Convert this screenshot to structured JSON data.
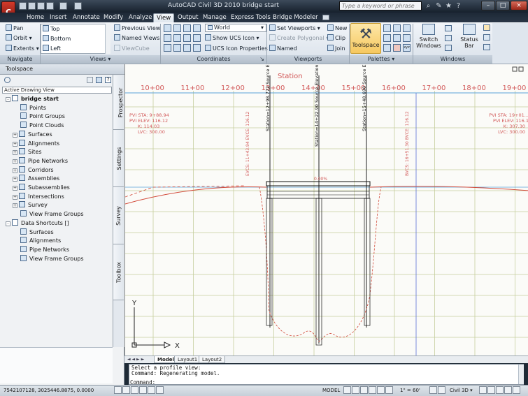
{
  "app": {
    "logo": "C",
    "title": "AutoCAD Civil 3D 2010    bridge start",
    "search_placeholder": "Type a keyword or phrase"
  },
  "ribbon_tabs": [
    "Home",
    "Insert",
    "Annotate",
    "Modify",
    "Analyze",
    "View",
    "Output",
    "Manage",
    "Express Tools",
    "Bridge Modeler"
  ],
  "active_tab": "View",
  "ribbon": {
    "navigate": {
      "label": "Navigate",
      "items": [
        "Pan",
        "Orbit",
        "Extents"
      ]
    },
    "views": {
      "label": "Views",
      "list": [
        "Top",
        "Bottom",
        "Left"
      ],
      "buttons": [
        "Previous View",
        "Named Views",
        "ViewCube"
      ]
    },
    "coordinates": {
      "label": "Coordinates",
      "ucs_combo": "World",
      "show_ucs": "Show UCS Icon",
      "ucs_props": "UCS Icon Properties"
    },
    "viewports": {
      "label": "Viewports",
      "set": "Set Viewports",
      "create": "Create Polygonal",
      "named": "Named",
      "new": "New",
      "clip": "Clip",
      "join": "Join"
    },
    "palettes": {
      "label": "Palettes",
      "toolspace": "Toolspace"
    },
    "windows": {
      "label": "Windows",
      "switch": "Switch Windows",
      "status": "Status Bar"
    }
  },
  "toolspace": {
    "title": "Toolspace",
    "view_combo": "Active Drawing View",
    "tree": [
      {
        "label": "bridge start",
        "level": 0,
        "bold": true,
        "expander": "-"
      },
      {
        "label": "Points",
        "level": 1
      },
      {
        "label": "Point Groups",
        "level": 1
      },
      {
        "label": "Point Clouds",
        "level": 1
      },
      {
        "label": "Surfaces",
        "level": 1,
        "expander": "+"
      },
      {
        "label": "Alignments",
        "level": 1,
        "expander": "+"
      },
      {
        "label": "Sites",
        "level": 1,
        "expander": "+"
      },
      {
        "label": "Pipe Networks",
        "level": 1,
        "expander": "+"
      },
      {
        "label": "Corridors",
        "level": 1,
        "expander": "+"
      },
      {
        "label": "Assemblies",
        "level": 1,
        "expander": "+"
      },
      {
        "label": "Subassemblies",
        "level": 1,
        "expander": "+"
      },
      {
        "label": "Intersections",
        "level": 1,
        "expander": "+"
      },
      {
        "label": "Survey",
        "level": 1,
        "expander": "+"
      },
      {
        "label": "View Frame Groups",
        "level": 1
      },
      {
        "label": "Data Shortcuts []",
        "level": 0,
        "expander": "-"
      },
      {
        "label": "Surfaces",
        "level": 1
      },
      {
        "label": "Alignments",
        "level": 1
      },
      {
        "label": "Pipe Networks",
        "level": 1
      },
      {
        "label": "View Frame Groups",
        "level": 1
      }
    ],
    "vertical_tabs": [
      "Prospector",
      "Settings",
      "Survey",
      "Toolbox"
    ]
  },
  "drawing": {
    "header": "Station",
    "stations": [
      "10+00",
      "11+00",
      "12+00",
      "13+00",
      "14+00",
      "15+00",
      "16+00",
      "17+00",
      "18+00",
      "19+00"
    ],
    "pvi_left": [
      "PVI STA: 9+88.94",
      "PVI ELEV: 116.12",
      "K: 114.03",
      "LVC: 300.00"
    ],
    "pvi_right": [
      "PVI STA: 19+01...",
      "PVI ELEV: 116.1",
      "K: 307.30",
      "LVC: 300.00"
    ],
    "station_labels": [
      "Station=12+98.772 Source Elevation=96.857",
      "Station=14+22.90 Source Elevation=83.820",
      "Station=15+48.690 Source Elevation=96.314"
    ],
    "evcs_left": "EVCS: 11+43.94 EVCE: 116.12",
    "bvcs_right": "BVCS: 16+51.30 BVCE: 116.12",
    "grade": "0.00%",
    "ucs_x": "X",
    "ucs_y": "Y"
  },
  "layout_tabs": [
    "Model",
    "Layout1",
    "Layout2"
  ],
  "command_lines": [
    "Select a profile view:",
    "Command: Regenerating model.",
    "Command:"
  ],
  "status": {
    "coords": "7542107128, 3025446.8875, 0.0000",
    "model": "MODEL",
    "scale": "1\" = 60'",
    "workspace": "Civil 3D"
  },
  "colors": {
    "accent": "#f6c860",
    "profile": "#d24a3a",
    "grid": "#c6cf9d",
    "station_axis": "#5aa0d8"
  }
}
